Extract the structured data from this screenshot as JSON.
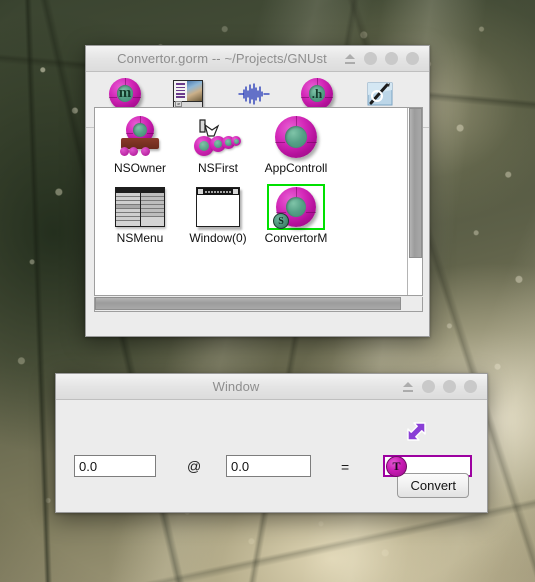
{
  "desktop": {
    "wallpaper_description": "misty sunlit forest",
    "colors": {
      "dark_green": "#3a4430",
      "mist": "#c6bc98",
      "highlight": "#e9e2cb"
    }
  },
  "gorm_window": {
    "title": "Convertor.gorm  --  ~/Projects/GNUst",
    "controls": {
      "eject_label": "eject-glyph",
      "dots": [
        "minimize",
        "maximize",
        "close"
      ]
    },
    "toolbar": {
      "items": [
        {
          "label": "Objects",
          "icon": "objects-torus-m-icon",
          "letter": "m"
        },
        {
          "label": "Images",
          "icon": "images-icon",
          "letter": ""
        },
        {
          "label": "Sounds",
          "icon": "sounds-waveform-icon",
          "letter": ""
        },
        {
          "label": "Classes",
          "icon": "classes-torus-h-icon",
          "letter": ".h"
        },
        {
          "label": "File",
          "icon": "file-pen-icon",
          "letter": ""
        }
      ]
    },
    "palette": {
      "objects": [
        {
          "label": "NSOwner",
          "icon": "nsowner-icon",
          "selected": false,
          "badge": ""
        },
        {
          "label": "NSFirst",
          "icon": "nsfirst-icon",
          "selected": false,
          "badge": ""
        },
        {
          "label": "AppControll",
          "icon": "appcontroll-icon",
          "selected": false,
          "badge": ""
        },
        {
          "label": "NSMenu",
          "icon": "nsmenu-icon",
          "selected": false,
          "badge": ""
        },
        {
          "label": "Window(0)",
          "icon": "window-mini-icon",
          "selected": false,
          "badge": ""
        },
        {
          "label": "ConvertorM",
          "icon": "convertorm-icon",
          "selected": true,
          "badge": "S"
        }
      ],
      "selection_color": "#00e000"
    },
    "scrollbars": {
      "vertical": "v-scrollbar",
      "horizontal": "h-scrollbar"
    }
  },
  "convertor_window": {
    "title": "Window",
    "controls": {
      "eject_label": "eject-glyph",
      "dots": [
        "minimize",
        "maximize",
        "close"
      ]
    },
    "form": {
      "field_a": {
        "value": "0.0",
        "placeholder": "0.0"
      },
      "operator_1": "@",
      "field_b": {
        "value": "0.0",
        "placeholder": "0.0"
      },
      "operator_2": "=",
      "field_c": {
        "value": "",
        "placeholder": ""
      },
      "drop_badge_letter": "T",
      "drop_target_border_color": "#9c00a0",
      "cursor": "drag-arrow-cursor"
    },
    "convert_button": "Convert"
  }
}
